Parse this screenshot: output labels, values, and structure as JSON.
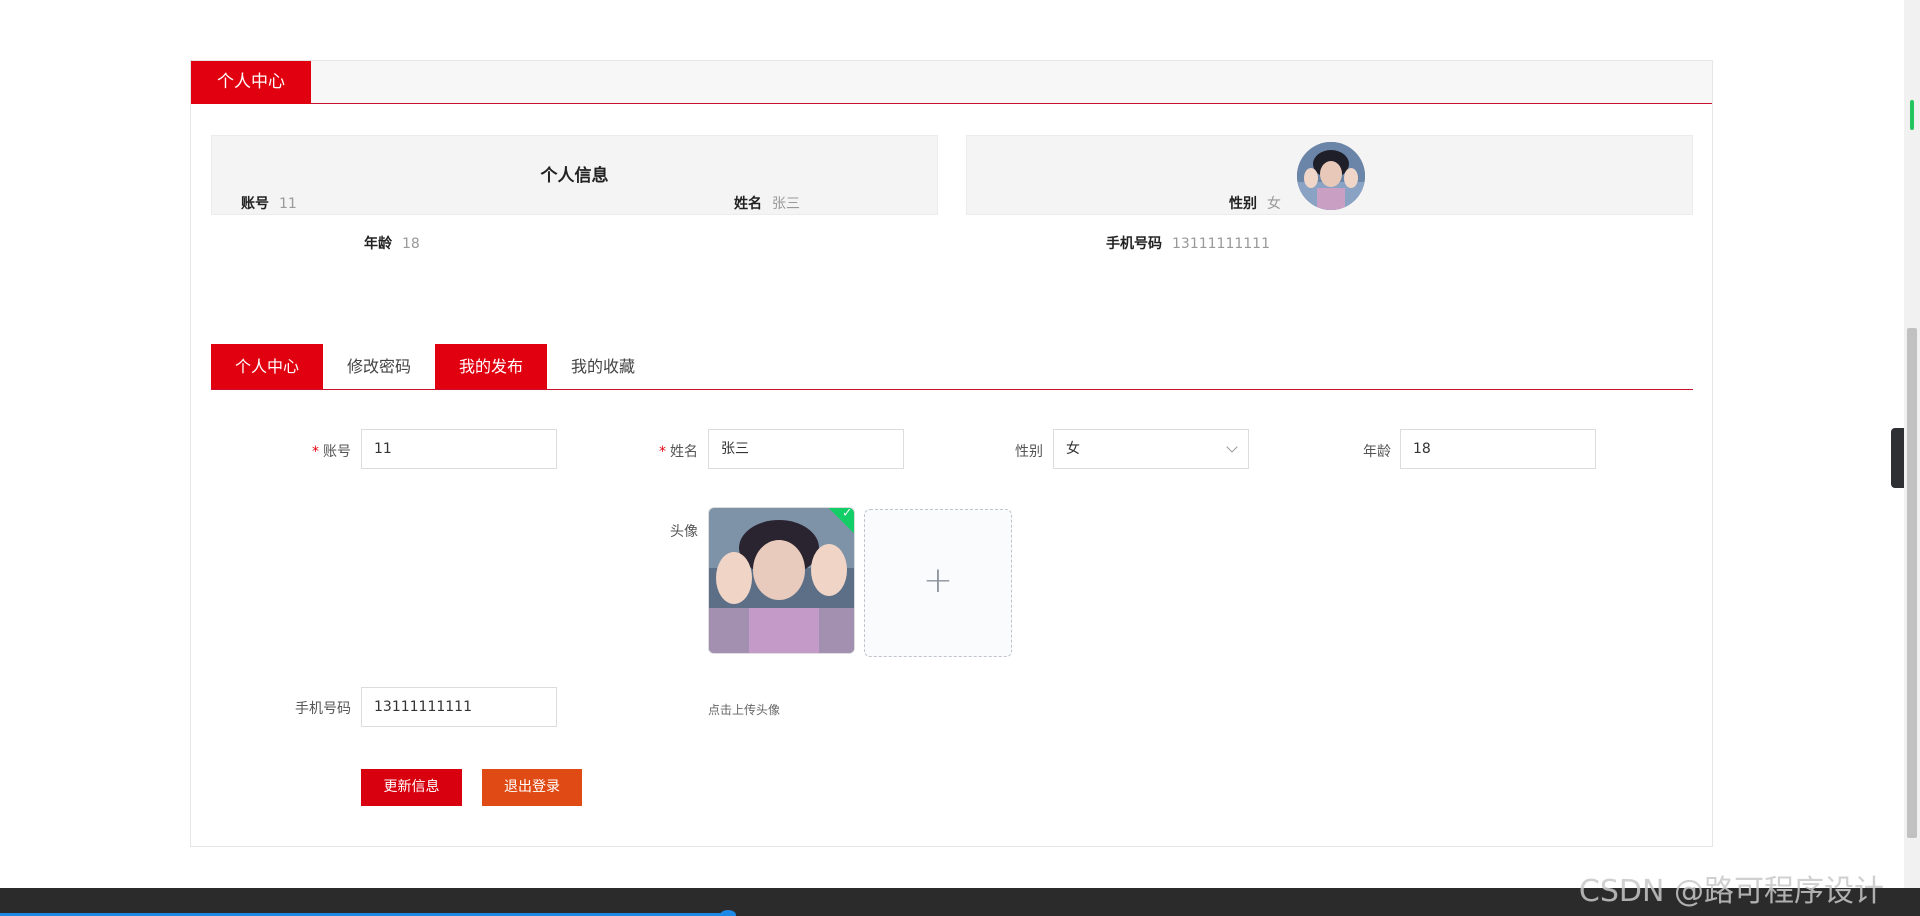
{
  "header": {
    "title": "个人中心"
  },
  "info": {
    "section_label": "个人信息",
    "account": {
      "label": "账号",
      "value": "11"
    },
    "name": {
      "label": "姓名",
      "value": "张三"
    },
    "gender": {
      "label": "性别",
      "value": "女"
    },
    "age": {
      "label": "年龄",
      "value": "18"
    },
    "phone": {
      "label": "手机号码",
      "value": "13111111111"
    }
  },
  "tabs": [
    {
      "label": "个人中心",
      "active": true
    },
    {
      "label": "修改密码",
      "active": false
    },
    {
      "label": "我的发布",
      "active": true
    },
    {
      "label": "我的收藏",
      "active": false
    }
  ],
  "form": {
    "account_label": "账号",
    "account_value": "11",
    "name_label": "姓名",
    "name_value": "张三",
    "gender_label": "性别",
    "gender_value": "女",
    "age_label": "年龄",
    "age_value": "18",
    "avatar_label": "头像",
    "avatar_tip": "点击上传头像",
    "phone_label": "手机号码",
    "phone_value": "13111111111",
    "required_mark": "*"
  },
  "buttons": {
    "update": "更新信息",
    "logout": "退出登录"
  },
  "watermark": "CSDN @路可程序设计",
  "colors": {
    "primary": "#e10010",
    "secondary": "#e04a14",
    "success": "#13ce66"
  }
}
